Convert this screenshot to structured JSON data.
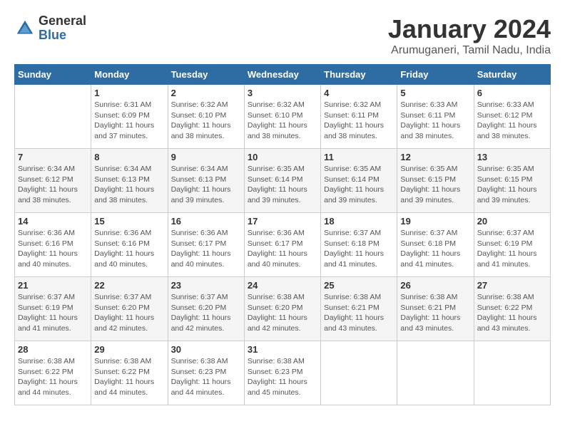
{
  "header": {
    "logo": {
      "general": "General",
      "blue": "Blue"
    },
    "title": "January 2024",
    "subtitle": "Arumuganeri, Tamil Nadu, India"
  },
  "calendar": {
    "days_of_week": [
      "Sunday",
      "Monday",
      "Tuesday",
      "Wednesday",
      "Thursday",
      "Friday",
      "Saturday"
    ],
    "weeks": [
      [
        {
          "day": "",
          "info": ""
        },
        {
          "day": "1",
          "info": "Sunrise: 6:31 AM\nSunset: 6:09 PM\nDaylight: 11 hours\nand 37 minutes."
        },
        {
          "day": "2",
          "info": "Sunrise: 6:32 AM\nSunset: 6:10 PM\nDaylight: 11 hours\nand 38 minutes."
        },
        {
          "day": "3",
          "info": "Sunrise: 6:32 AM\nSunset: 6:10 PM\nDaylight: 11 hours\nand 38 minutes."
        },
        {
          "day": "4",
          "info": "Sunrise: 6:32 AM\nSunset: 6:11 PM\nDaylight: 11 hours\nand 38 minutes."
        },
        {
          "day": "5",
          "info": "Sunrise: 6:33 AM\nSunset: 6:11 PM\nDaylight: 11 hours\nand 38 minutes."
        },
        {
          "day": "6",
          "info": "Sunrise: 6:33 AM\nSunset: 6:12 PM\nDaylight: 11 hours\nand 38 minutes."
        }
      ],
      [
        {
          "day": "7",
          "info": "Sunrise: 6:34 AM\nSunset: 6:12 PM\nDaylight: 11 hours\nand 38 minutes."
        },
        {
          "day": "8",
          "info": "Sunrise: 6:34 AM\nSunset: 6:13 PM\nDaylight: 11 hours\nand 38 minutes."
        },
        {
          "day": "9",
          "info": "Sunrise: 6:34 AM\nSunset: 6:13 PM\nDaylight: 11 hours\nand 39 minutes."
        },
        {
          "day": "10",
          "info": "Sunrise: 6:35 AM\nSunset: 6:14 PM\nDaylight: 11 hours\nand 39 minutes."
        },
        {
          "day": "11",
          "info": "Sunrise: 6:35 AM\nSunset: 6:14 PM\nDaylight: 11 hours\nand 39 minutes."
        },
        {
          "day": "12",
          "info": "Sunrise: 6:35 AM\nSunset: 6:15 PM\nDaylight: 11 hours\nand 39 minutes."
        },
        {
          "day": "13",
          "info": "Sunrise: 6:35 AM\nSunset: 6:15 PM\nDaylight: 11 hours\nand 39 minutes."
        }
      ],
      [
        {
          "day": "14",
          "info": "Sunrise: 6:36 AM\nSunset: 6:16 PM\nDaylight: 11 hours\nand 40 minutes."
        },
        {
          "day": "15",
          "info": "Sunrise: 6:36 AM\nSunset: 6:16 PM\nDaylight: 11 hours\nand 40 minutes."
        },
        {
          "day": "16",
          "info": "Sunrise: 6:36 AM\nSunset: 6:17 PM\nDaylight: 11 hours\nand 40 minutes."
        },
        {
          "day": "17",
          "info": "Sunrise: 6:36 AM\nSunset: 6:17 PM\nDaylight: 11 hours\nand 40 minutes."
        },
        {
          "day": "18",
          "info": "Sunrise: 6:37 AM\nSunset: 6:18 PM\nDaylight: 11 hours\nand 41 minutes."
        },
        {
          "day": "19",
          "info": "Sunrise: 6:37 AM\nSunset: 6:18 PM\nDaylight: 11 hours\nand 41 minutes."
        },
        {
          "day": "20",
          "info": "Sunrise: 6:37 AM\nSunset: 6:19 PM\nDaylight: 11 hours\nand 41 minutes."
        }
      ],
      [
        {
          "day": "21",
          "info": "Sunrise: 6:37 AM\nSunset: 6:19 PM\nDaylight: 11 hours\nand 41 minutes."
        },
        {
          "day": "22",
          "info": "Sunrise: 6:37 AM\nSunset: 6:20 PM\nDaylight: 11 hours\nand 42 minutes."
        },
        {
          "day": "23",
          "info": "Sunrise: 6:37 AM\nSunset: 6:20 PM\nDaylight: 11 hours\nand 42 minutes."
        },
        {
          "day": "24",
          "info": "Sunrise: 6:38 AM\nSunset: 6:20 PM\nDaylight: 11 hours\nand 42 minutes."
        },
        {
          "day": "25",
          "info": "Sunrise: 6:38 AM\nSunset: 6:21 PM\nDaylight: 11 hours\nand 43 minutes."
        },
        {
          "day": "26",
          "info": "Sunrise: 6:38 AM\nSunset: 6:21 PM\nDaylight: 11 hours\nand 43 minutes."
        },
        {
          "day": "27",
          "info": "Sunrise: 6:38 AM\nSunset: 6:22 PM\nDaylight: 11 hours\nand 43 minutes."
        }
      ],
      [
        {
          "day": "28",
          "info": "Sunrise: 6:38 AM\nSunset: 6:22 PM\nDaylight: 11 hours\nand 44 minutes."
        },
        {
          "day": "29",
          "info": "Sunrise: 6:38 AM\nSunset: 6:22 PM\nDaylight: 11 hours\nand 44 minutes."
        },
        {
          "day": "30",
          "info": "Sunrise: 6:38 AM\nSunset: 6:23 PM\nDaylight: 11 hours\nand 44 minutes."
        },
        {
          "day": "31",
          "info": "Sunrise: 6:38 AM\nSunset: 6:23 PM\nDaylight: 11 hours\nand 45 minutes."
        },
        {
          "day": "",
          "info": ""
        },
        {
          "day": "",
          "info": ""
        },
        {
          "day": "",
          "info": ""
        }
      ]
    ]
  }
}
